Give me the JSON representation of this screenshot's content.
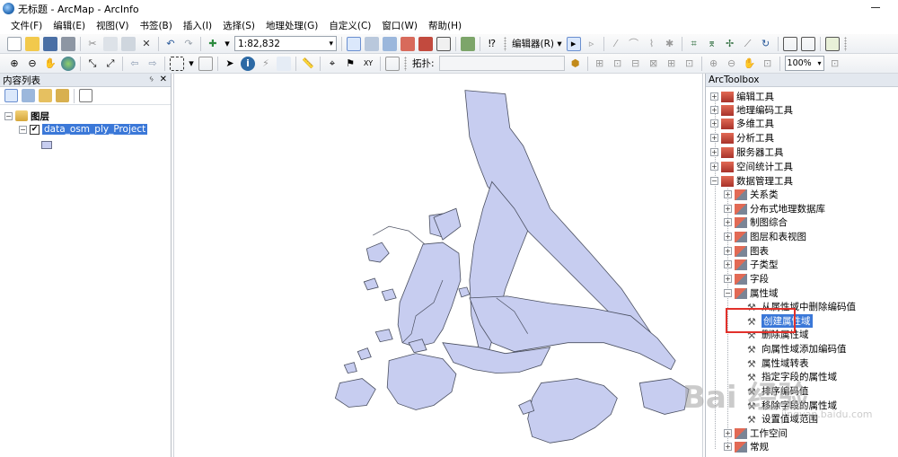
{
  "window": {
    "title": "无标题 - ArcMap - ArcInfo"
  },
  "menu": [
    {
      "label": "文件(F)"
    },
    {
      "label": "编辑(E)"
    },
    {
      "label": "视图(V)"
    },
    {
      "label": "书签(B)"
    },
    {
      "label": "插入(I)"
    },
    {
      "label": "选择(S)"
    },
    {
      "label": "地理处理(G)"
    },
    {
      "label": "自定义(C)"
    },
    {
      "label": "窗口(W)"
    },
    {
      "label": "帮助(H)"
    }
  ],
  "toolbar": {
    "scale_value": "1:82,832",
    "editor_label": "编辑器(R) ▾",
    "snapping_label": "拓扑:",
    "zoom_value": "100%"
  },
  "toc": {
    "title": "内容列表",
    "pin_label": "📌 ×",
    "layers_group": "图层",
    "layer_name": "data_osm_ply_Project"
  },
  "toolbox": {
    "title": "ArcToolbox",
    "items": [
      {
        "label": "编辑工具"
      },
      {
        "label": "地理编码工具"
      },
      {
        "label": "多维工具"
      },
      {
        "label": "分析工具"
      },
      {
        "label": "服务器工具"
      },
      {
        "label": "空间统计工具"
      },
      {
        "label": "数据管理工具"
      },
      {
        "label": "关系类"
      },
      {
        "label": "分布式地理数据库"
      },
      {
        "label": "制图综合"
      },
      {
        "label": "图层和表视图"
      },
      {
        "label": "图表"
      },
      {
        "label": "子类型"
      },
      {
        "label": "字段"
      },
      {
        "label": "属性域"
      },
      {
        "label": "从属性域中删除编码值"
      },
      {
        "label": "创建属性域"
      },
      {
        "label": "删除属性域"
      },
      {
        "label": "向属性域添加编码值"
      },
      {
        "label": "属性域转表"
      },
      {
        "label": "指定字段的属性域"
      },
      {
        "label": "排序编码值"
      },
      {
        "label": "移除字段的属性域"
      },
      {
        "label": "设置值域范围"
      },
      {
        "label": "工作空间"
      },
      {
        "label": "常规"
      }
    ]
  },
  "watermark": {
    "text": "Bai 经验",
    "sub": "jingyan.baidu.com"
  },
  "colors": {
    "polygon_fill": "#c7cdf0",
    "polygon_stroke": "#4a4f60",
    "highlight": "#e2312b",
    "selection": "#3b78d8"
  }
}
